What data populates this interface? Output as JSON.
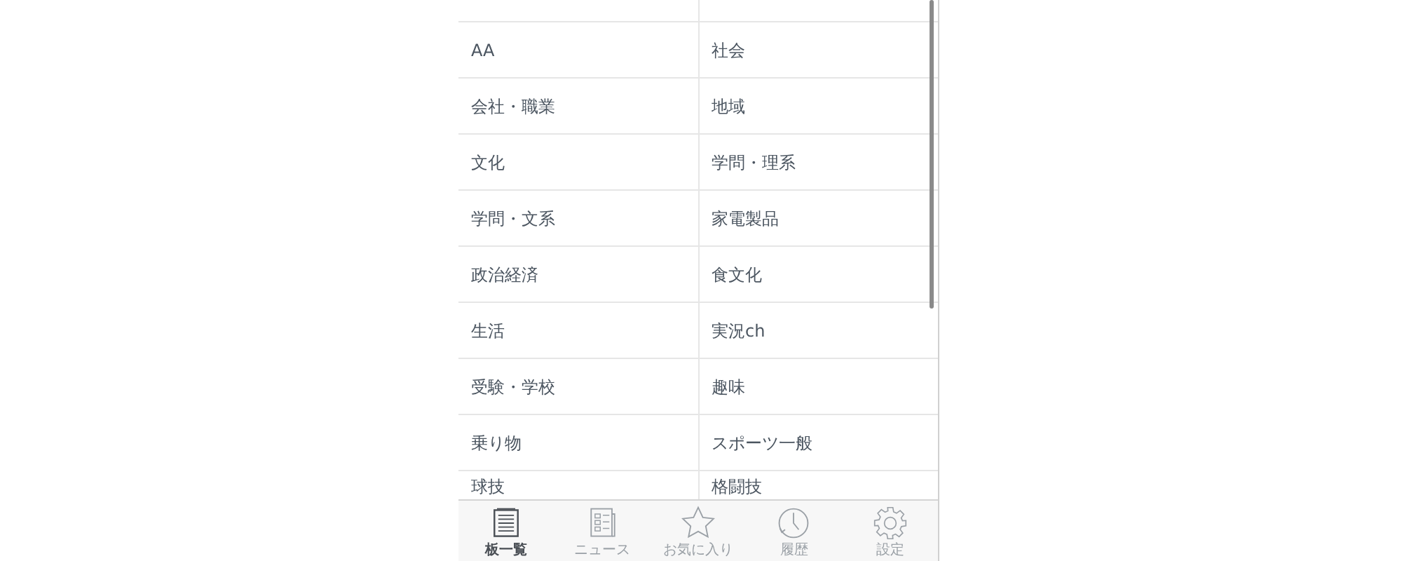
{
  "categories": [
    [
      "AA",
      "社会"
    ],
    [
      "会社・職業",
      "地域"
    ],
    [
      "文化",
      "学問・理系"
    ],
    [
      "学問・文系",
      "家電製品"
    ],
    [
      "政治経済",
      "食文化"
    ],
    [
      "生活",
      "実況ch"
    ],
    [
      "受験・学校",
      "趣味"
    ],
    [
      "乗り物",
      "スポーツ一般"
    ],
    [
      "球技",
      "格闘技"
    ]
  ],
  "tabs": [
    {
      "label": "板一覧",
      "kind": "boards",
      "selected": true
    },
    {
      "label": "ニュース",
      "kind": "news",
      "selected": false
    },
    {
      "label": "お気に入り",
      "kind": "favorites",
      "selected": false
    },
    {
      "label": "履歴",
      "kind": "history",
      "selected": false
    },
    {
      "label": "設定",
      "kind": "settings",
      "selected": false
    }
  ]
}
